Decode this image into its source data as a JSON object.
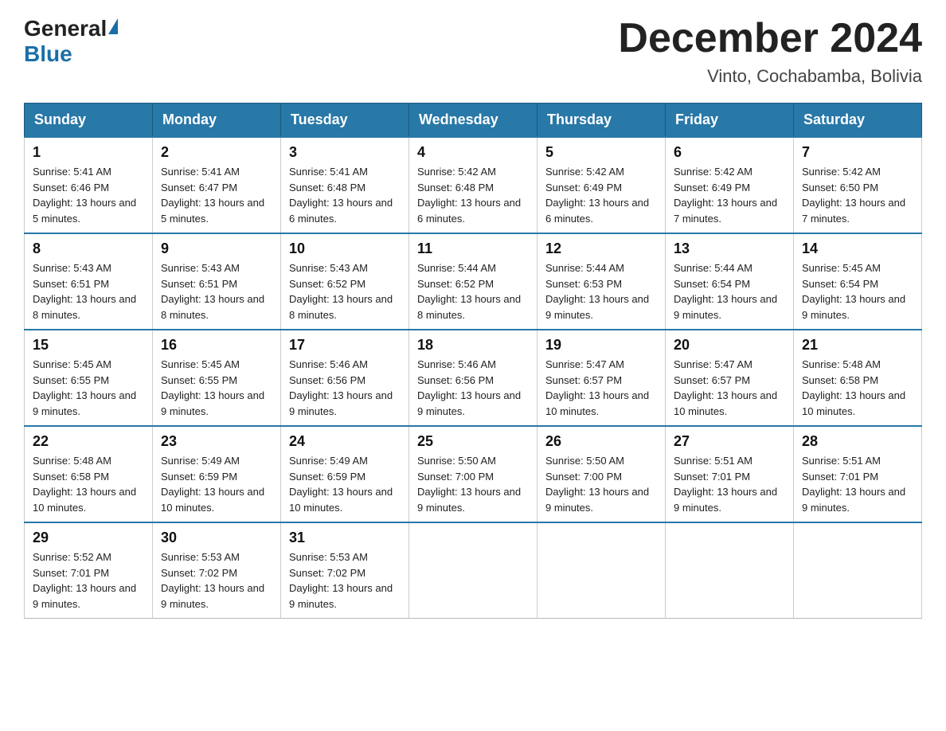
{
  "logo": {
    "text_general": "General",
    "text_blue": "Blue"
  },
  "header": {
    "title": "December 2024",
    "subtitle": "Vinto, Cochabamba, Bolivia"
  },
  "weekdays": [
    "Sunday",
    "Monday",
    "Tuesday",
    "Wednesday",
    "Thursday",
    "Friday",
    "Saturday"
  ],
  "weeks": [
    [
      {
        "day": "1",
        "sunrise": "5:41 AM",
        "sunset": "6:46 PM",
        "daylight": "13 hours and 5 minutes."
      },
      {
        "day": "2",
        "sunrise": "5:41 AM",
        "sunset": "6:47 PM",
        "daylight": "13 hours and 5 minutes."
      },
      {
        "day": "3",
        "sunrise": "5:41 AM",
        "sunset": "6:48 PM",
        "daylight": "13 hours and 6 minutes."
      },
      {
        "day": "4",
        "sunrise": "5:42 AM",
        "sunset": "6:48 PM",
        "daylight": "13 hours and 6 minutes."
      },
      {
        "day": "5",
        "sunrise": "5:42 AM",
        "sunset": "6:49 PM",
        "daylight": "13 hours and 6 minutes."
      },
      {
        "day": "6",
        "sunrise": "5:42 AM",
        "sunset": "6:49 PM",
        "daylight": "13 hours and 7 minutes."
      },
      {
        "day": "7",
        "sunrise": "5:42 AM",
        "sunset": "6:50 PM",
        "daylight": "13 hours and 7 minutes."
      }
    ],
    [
      {
        "day": "8",
        "sunrise": "5:43 AM",
        "sunset": "6:51 PM",
        "daylight": "13 hours and 8 minutes."
      },
      {
        "day": "9",
        "sunrise": "5:43 AM",
        "sunset": "6:51 PM",
        "daylight": "13 hours and 8 minutes."
      },
      {
        "day": "10",
        "sunrise": "5:43 AM",
        "sunset": "6:52 PM",
        "daylight": "13 hours and 8 minutes."
      },
      {
        "day": "11",
        "sunrise": "5:44 AM",
        "sunset": "6:52 PM",
        "daylight": "13 hours and 8 minutes."
      },
      {
        "day": "12",
        "sunrise": "5:44 AM",
        "sunset": "6:53 PM",
        "daylight": "13 hours and 9 minutes."
      },
      {
        "day": "13",
        "sunrise": "5:44 AM",
        "sunset": "6:54 PM",
        "daylight": "13 hours and 9 minutes."
      },
      {
        "day": "14",
        "sunrise": "5:45 AM",
        "sunset": "6:54 PM",
        "daylight": "13 hours and 9 minutes."
      }
    ],
    [
      {
        "day": "15",
        "sunrise": "5:45 AM",
        "sunset": "6:55 PM",
        "daylight": "13 hours and 9 minutes."
      },
      {
        "day": "16",
        "sunrise": "5:45 AM",
        "sunset": "6:55 PM",
        "daylight": "13 hours and 9 minutes."
      },
      {
        "day": "17",
        "sunrise": "5:46 AM",
        "sunset": "6:56 PM",
        "daylight": "13 hours and 9 minutes."
      },
      {
        "day": "18",
        "sunrise": "5:46 AM",
        "sunset": "6:56 PM",
        "daylight": "13 hours and 9 minutes."
      },
      {
        "day": "19",
        "sunrise": "5:47 AM",
        "sunset": "6:57 PM",
        "daylight": "13 hours and 10 minutes."
      },
      {
        "day": "20",
        "sunrise": "5:47 AM",
        "sunset": "6:57 PM",
        "daylight": "13 hours and 10 minutes."
      },
      {
        "day": "21",
        "sunrise": "5:48 AM",
        "sunset": "6:58 PM",
        "daylight": "13 hours and 10 minutes."
      }
    ],
    [
      {
        "day": "22",
        "sunrise": "5:48 AM",
        "sunset": "6:58 PM",
        "daylight": "13 hours and 10 minutes."
      },
      {
        "day": "23",
        "sunrise": "5:49 AM",
        "sunset": "6:59 PM",
        "daylight": "13 hours and 10 minutes."
      },
      {
        "day": "24",
        "sunrise": "5:49 AM",
        "sunset": "6:59 PM",
        "daylight": "13 hours and 10 minutes."
      },
      {
        "day": "25",
        "sunrise": "5:50 AM",
        "sunset": "7:00 PM",
        "daylight": "13 hours and 9 minutes."
      },
      {
        "day": "26",
        "sunrise": "5:50 AM",
        "sunset": "7:00 PM",
        "daylight": "13 hours and 9 minutes."
      },
      {
        "day": "27",
        "sunrise": "5:51 AM",
        "sunset": "7:01 PM",
        "daylight": "13 hours and 9 minutes."
      },
      {
        "day": "28",
        "sunrise": "5:51 AM",
        "sunset": "7:01 PM",
        "daylight": "13 hours and 9 minutes."
      }
    ],
    [
      {
        "day": "29",
        "sunrise": "5:52 AM",
        "sunset": "7:01 PM",
        "daylight": "13 hours and 9 minutes."
      },
      {
        "day": "30",
        "sunrise": "5:53 AM",
        "sunset": "7:02 PM",
        "daylight": "13 hours and 9 minutes."
      },
      {
        "day": "31",
        "sunrise": "5:53 AM",
        "sunset": "7:02 PM",
        "daylight": "13 hours and 9 minutes."
      },
      null,
      null,
      null,
      null
    ]
  ]
}
